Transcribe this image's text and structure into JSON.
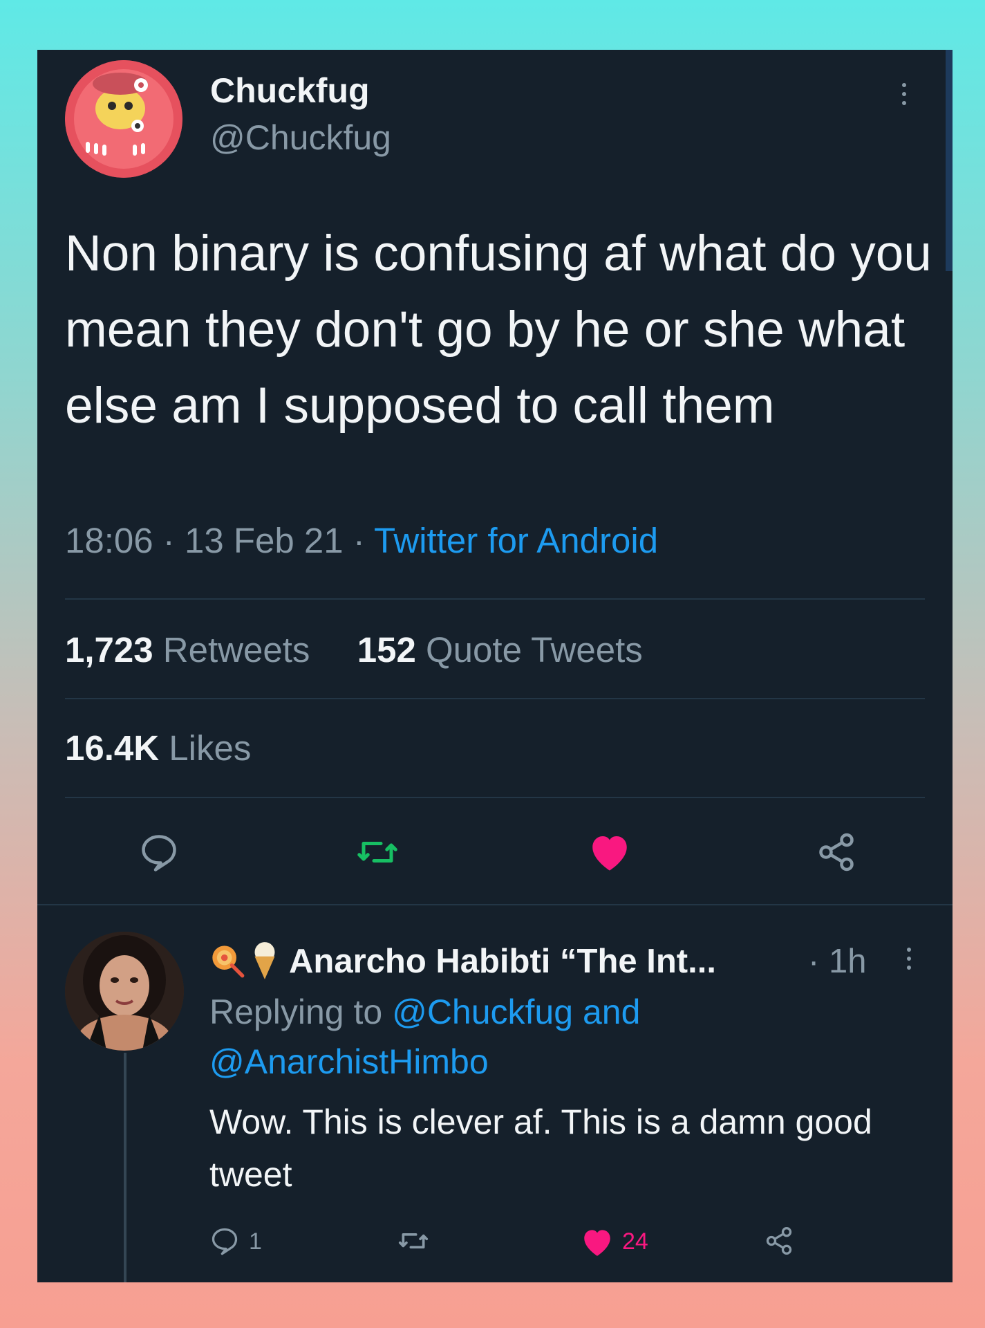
{
  "tweet": {
    "display_name": "Chuckfug",
    "handle": "@Chuckfug",
    "text": "Non binary is confusing af what do you mean they don't go by he or she what else am I supposed to call them",
    "time": "18:06",
    "date": "13 Feb 21",
    "separator": "·",
    "source": "Twitter for Android",
    "retweets_count": "1,723",
    "retweets_label": "Retweets",
    "quote_count": "152",
    "quote_label": "Quote Tweets",
    "likes_count": "16.4K",
    "likes_label": "Likes",
    "actions": [
      "reply-icon",
      "retweet-icon",
      "like-icon",
      "share-icon"
    ],
    "liked": true
  },
  "reply": {
    "display_name": "Anarcho Habibti “The Int...",
    "emoji_prefix": [
      "lollipop-icon",
      "ice-cream-icon"
    ],
    "time_sep": "·",
    "time": "1h",
    "replying_label": "Replying to",
    "replying_users": [
      "@Chuckfug",
      "@AnarchistHimbo"
    ],
    "replying_and": "and",
    "text": "Wow. This is clever af. This is a damn good tweet",
    "reply_count": "1",
    "like_count": "24",
    "liked": true
  },
  "colors": {
    "background": "#15202b",
    "text": "#f2f5f7",
    "secondary": "#8899a6",
    "link": "#1d9bf0",
    "retweet": "#17bf63",
    "like": "#f91880"
  }
}
